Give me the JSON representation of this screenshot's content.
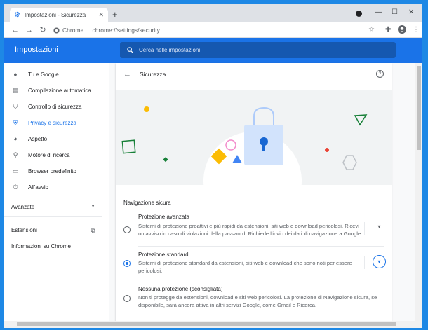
{
  "browser": {
    "tab_title": "Impostazioni - Sicurezza",
    "new_tab": "+",
    "omnibox_site": "Chrome",
    "omnibox_url": "chrome://settings/security"
  },
  "settings_header": {
    "title": "Impostazioni",
    "search_placeholder": "Cerca nelle impostazioni"
  },
  "sidebar": {
    "items": [
      {
        "label": "Tu e Google",
        "icon": "person-icon"
      },
      {
        "label": "Compilazione automatica",
        "icon": "clipboard-icon"
      },
      {
        "label": "Controllo di sicurezza",
        "icon": "shield-check-icon"
      },
      {
        "label": "Privacy e sicurezza",
        "icon": "shield-icon"
      },
      {
        "label": "Aspetto",
        "icon": "palette-icon"
      },
      {
        "label": "Motore di ricerca",
        "icon": "search-icon"
      },
      {
        "label": "Browser predefinito",
        "icon": "browser-icon"
      },
      {
        "label": "All'avvio",
        "icon": "power-icon"
      }
    ],
    "advanced": "Avanzate",
    "extensions": "Estensioni",
    "about": "Informazioni su Chrome"
  },
  "page": {
    "title": "Sicurezza",
    "section_title": "Navigazione sicura",
    "options": [
      {
        "title": "Protezione avanzata",
        "desc": "Sistemi di protezione proattivi e più rapidi da estensioni, siti web e download pericolosi. Ricevi un avviso in caso di violazioni della password. Richiede l'invio dei dati di navigazione a Google.",
        "selected": false
      },
      {
        "title": "Protezione standard",
        "desc": "Sistemi di protezione standard da estensioni, siti web e download che sono noti per essere pericolosi.",
        "selected": true
      },
      {
        "title": "Nessuna protezione (sconsigliata)",
        "desc": "Non ti protegge da estensioni, download e siti web pericolosi. La protezione di Navigazione sicura, se disponibile, sarà ancora attiva in altri servizi Google, come Gmail e Ricerca.",
        "selected": false
      }
    ]
  },
  "colors": {
    "accent": "#1a73e8",
    "header_bg": "#1a73e8",
    "desktop_bg": "#1e88e5"
  }
}
